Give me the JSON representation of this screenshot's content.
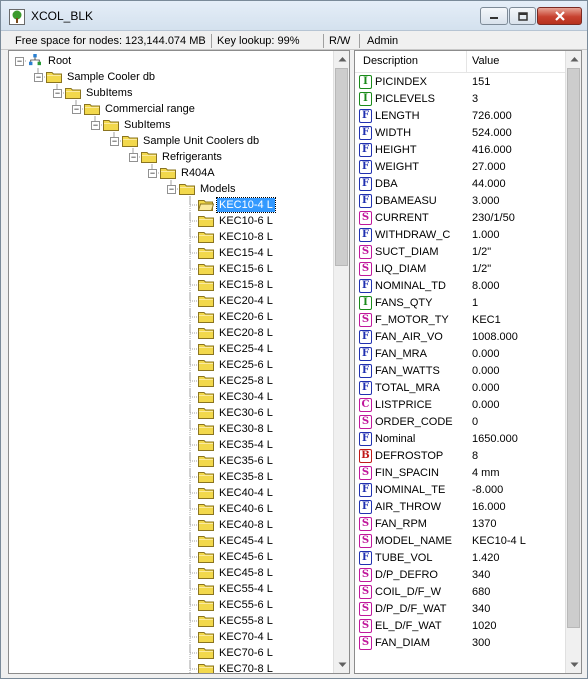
{
  "window": {
    "title": "XCOL_BLK"
  },
  "colors": {
    "type_I": "#1a8a1a",
    "type_F": "#2030b0",
    "type_S": "#c0189c",
    "type_C": "#c0189c",
    "type_B": "#c01818",
    "selection": "#3399ff",
    "folder": "#f2d84c"
  },
  "status": {
    "free_space_label": "Free space for nodes:",
    "free_space_value": "123,144.074 MB",
    "key_lookup": "Key lookup: 99%",
    "mode": "R/W",
    "user": "Admin"
  },
  "tree": {
    "items": [
      {
        "label": "Root",
        "depth": 0,
        "kind": "root",
        "expanded": true
      },
      {
        "label": "Sample Cooler db",
        "depth": 1,
        "kind": "folder",
        "expanded": true
      },
      {
        "label": "SubItems",
        "depth": 2,
        "kind": "folder",
        "expanded": true
      },
      {
        "label": "Commercial range",
        "depth": 3,
        "kind": "folder",
        "expanded": true
      },
      {
        "label": "SubItems",
        "depth": 4,
        "kind": "folder",
        "expanded": true
      },
      {
        "label": "Sample Unit Coolers db",
        "depth": 5,
        "kind": "folder",
        "expanded": true
      },
      {
        "label": "Refrigerants",
        "depth": 6,
        "kind": "folder",
        "expanded": true
      },
      {
        "label": "R404A",
        "depth": 7,
        "kind": "folder",
        "expanded": true
      },
      {
        "label": "Models",
        "depth": 8,
        "kind": "folder",
        "expanded": true
      },
      {
        "label": "KEC10-4 L",
        "depth": 9,
        "kind": "folder-open",
        "selected": true
      },
      {
        "label": "KEC10-6 L",
        "depth": 9,
        "kind": "folder"
      },
      {
        "label": "KEC10-8 L",
        "depth": 9,
        "kind": "folder"
      },
      {
        "label": "KEC15-4 L",
        "depth": 9,
        "kind": "folder"
      },
      {
        "label": "KEC15-6 L",
        "depth": 9,
        "kind": "folder"
      },
      {
        "label": "KEC15-8 L",
        "depth": 9,
        "kind": "folder"
      },
      {
        "label": "KEC20-4 L",
        "depth": 9,
        "kind": "folder"
      },
      {
        "label": "KEC20-6 L",
        "depth": 9,
        "kind": "folder"
      },
      {
        "label": "KEC20-8 L",
        "depth": 9,
        "kind": "folder"
      },
      {
        "label": "KEC25-4 L",
        "depth": 9,
        "kind": "folder"
      },
      {
        "label": "KEC25-6 L",
        "depth": 9,
        "kind": "folder"
      },
      {
        "label": "KEC25-8 L",
        "depth": 9,
        "kind": "folder"
      },
      {
        "label": "KEC30-4 L",
        "depth": 9,
        "kind": "folder"
      },
      {
        "label": "KEC30-6 L",
        "depth": 9,
        "kind": "folder"
      },
      {
        "label": "KEC30-8 L",
        "depth": 9,
        "kind": "folder"
      },
      {
        "label": "KEC35-4 L",
        "depth": 9,
        "kind": "folder"
      },
      {
        "label": "KEC35-6 L",
        "depth": 9,
        "kind": "folder"
      },
      {
        "label": "KEC35-8 L",
        "depth": 9,
        "kind": "folder"
      },
      {
        "label": "KEC40-4 L",
        "depth": 9,
        "kind": "folder"
      },
      {
        "label": "KEC40-6 L",
        "depth": 9,
        "kind": "folder"
      },
      {
        "label": "KEC40-8 L",
        "depth": 9,
        "kind": "folder"
      },
      {
        "label": "KEC45-4 L",
        "depth": 9,
        "kind": "folder"
      },
      {
        "label": "KEC45-6 L",
        "depth": 9,
        "kind": "folder"
      },
      {
        "label": "KEC45-8 L",
        "depth": 9,
        "kind": "folder"
      },
      {
        "label": "KEC55-4 L",
        "depth": 9,
        "kind": "folder"
      },
      {
        "label": "KEC55-6 L",
        "depth": 9,
        "kind": "folder"
      },
      {
        "label": "KEC55-8 L",
        "depth": 9,
        "kind": "folder"
      },
      {
        "label": "KEC70-4 L",
        "depth": 9,
        "kind": "folder"
      },
      {
        "label": "KEC70-6 L",
        "depth": 9,
        "kind": "folder"
      },
      {
        "label": "KEC70-8 L",
        "depth": 9,
        "kind": "folder"
      }
    ]
  },
  "properties": {
    "columns": [
      "Description",
      "Value"
    ],
    "rows": [
      {
        "type": "I",
        "name": "PICINDEX",
        "value": "151"
      },
      {
        "type": "I",
        "name": "PICLEVELS",
        "value": "3"
      },
      {
        "type": "F",
        "name": "LENGTH",
        "value": "726.000"
      },
      {
        "type": "F",
        "name": "WIDTH",
        "value": "524.000"
      },
      {
        "type": "F",
        "name": "HEIGHT",
        "value": "416.000"
      },
      {
        "type": "F",
        "name": "WEIGHT",
        "value": "27.000"
      },
      {
        "type": "F",
        "name": "DBA",
        "value": "44.000"
      },
      {
        "type": "F",
        "name": "DBAMEASU",
        "value": "3.000"
      },
      {
        "type": "S",
        "name": "CURRENT",
        "value": "230/1/50"
      },
      {
        "type": "F",
        "name": "WITHDRAW_C",
        "value": "1.000"
      },
      {
        "type": "S",
        "name": "SUCT_DIAM",
        "value": "1/2\""
      },
      {
        "type": "S",
        "name": "LIQ_DIAM",
        "value": "1/2\""
      },
      {
        "type": "F",
        "name": "NOMINAL_TD",
        "value": "8.000"
      },
      {
        "type": "I",
        "name": "FANS_QTY",
        "value": "1"
      },
      {
        "type": "S",
        "name": "F_MOTOR_TY",
        "value": "KEC1"
      },
      {
        "type": "F",
        "name": "FAN_AIR_VO",
        "value": "1008.000"
      },
      {
        "type": "F",
        "name": "FAN_MRA",
        "value": "0.000"
      },
      {
        "type": "F",
        "name": "FAN_WATTS",
        "value": "0.000"
      },
      {
        "type": "F",
        "name": "TOTAL_MRA",
        "value": "0.000"
      },
      {
        "type": "C",
        "name": "LISTPRICE",
        "value": "0.000"
      },
      {
        "type": "S",
        "name": "ORDER_CODE",
        "value": "0"
      },
      {
        "type": "F",
        "name": "Nominal",
        "value": "1650.000"
      },
      {
        "type": "B",
        "name": "DEFROSTOP",
        "value": "8"
      },
      {
        "type": "S",
        "name": "FIN_SPACIN",
        "value": "4 mm"
      },
      {
        "type": "F",
        "name": "NOMINAL_TE",
        "value": "-8.000"
      },
      {
        "type": "F",
        "name": "AIR_THROW",
        "value": "16.000"
      },
      {
        "type": "S",
        "name": "FAN_RPM",
        "value": "1370"
      },
      {
        "type": "S",
        "name": "MODEL_NAME",
        "value": "KEC10-4 L"
      },
      {
        "type": "F",
        "name": "TUBE_VOL",
        "value": "1.420"
      },
      {
        "type": "S",
        "name": "D/P_DEFRO",
        "value": "340"
      },
      {
        "type": "S",
        "name": "COIL_D/F_W",
        "value": "680"
      },
      {
        "type": "S",
        "name": "D/P_D/F_WAT",
        "value": "340"
      },
      {
        "type": "S",
        "name": "EL_D/F_WAT",
        "value": "1020"
      },
      {
        "type": "S",
        "name": "FAN_DIAM",
        "value": "300"
      }
    ]
  }
}
